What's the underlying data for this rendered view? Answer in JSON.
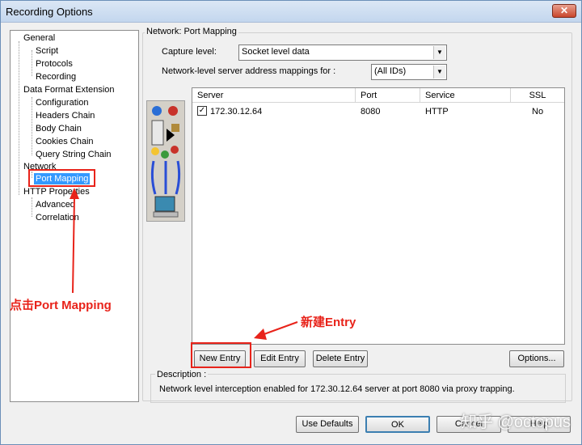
{
  "window": {
    "title": "Recording Options",
    "close_label": "✕"
  },
  "tree": {
    "items": [
      {
        "label": "General"
      },
      {
        "label": "Script"
      },
      {
        "label": "Protocols"
      },
      {
        "label": "Recording"
      },
      {
        "label": "Data Format Extension"
      },
      {
        "label": "Configuration"
      },
      {
        "label": "Headers Chain"
      },
      {
        "label": "Body Chain"
      },
      {
        "label": "Cookies Chain"
      },
      {
        "label": "Query String Chain"
      },
      {
        "label": "Network"
      },
      {
        "label": "Port Mapping"
      },
      {
        "label": "HTTP Properties"
      },
      {
        "label": "Advanced"
      },
      {
        "label": "Correlation"
      }
    ]
  },
  "panel": {
    "group_title": "Network: Port Mapping",
    "capture_label": "Capture level:",
    "capture_value": "Socket level data",
    "mapping_label": "Network-level server address mappings for :",
    "mapping_value": "(All IDs)"
  },
  "table": {
    "columns": [
      "Server",
      "Port",
      "Service",
      "SSL"
    ],
    "rows": [
      {
        "checked": "✓",
        "server": "172.30.12.64",
        "port": "8080",
        "service": "HTTP",
        "ssl": "No"
      }
    ]
  },
  "buttons": {
    "new_entry": "New Entry",
    "edit_entry": "Edit Entry",
    "delete_entry": "Delete Entry",
    "options": "Options...",
    "use_defaults": "Use Defaults",
    "ok": "OK",
    "cancel": "Cancel",
    "help": "Help"
  },
  "description": {
    "title": "Description :",
    "text": "Network level interception enabled for 172.30.12.64 server at port 8080 via proxy trapping."
  },
  "annotations": {
    "click_port_mapping": "点击Port Mapping",
    "new_entry": "新建Entry",
    "color": "#e8231a"
  },
  "watermark": "知乎 @octopus"
}
